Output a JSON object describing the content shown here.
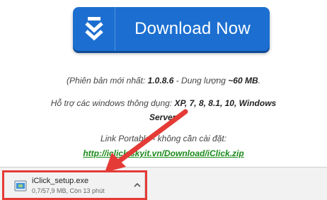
{
  "download_button": {
    "label": "Download Now",
    "icon": "double-chevron-down-icon",
    "color": "#1c6fd0"
  },
  "info": {
    "version_prefix": "(Phiên bản mới nhất: ",
    "version": "1.0.8.6",
    "size_prefix": " - Dung lượng ",
    "size": "~60 MB",
    "size_suffix": ".",
    "support_prefix": "Hỗ trợ các windows thông dụng: ",
    "support_list": "XP, 7, 8, 8.1, 10, Windows",
    "support_list_cont": "Server.",
    "portable_label": "Link Portable - không cần cài đặt:",
    "portable_url": "http://iclick.skyit.vn/Download/iClick.zip"
  },
  "download_shelf": {
    "file_name": "iClick_setup.exe",
    "status": "0,7/57,9 MB, Còn 13 phút",
    "file_icon": "installer-file-icon",
    "menu_icon": "chevron-up-icon"
  },
  "annotation": {
    "arrow_color": "#e53b36",
    "box_color": "#e53b36"
  }
}
